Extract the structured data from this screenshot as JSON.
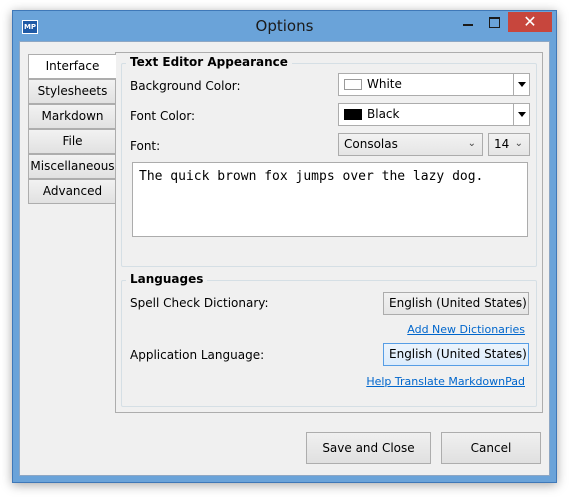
{
  "window": {
    "title": "Options",
    "app_icon": "MP"
  },
  "tabs": [
    {
      "label": "Interface",
      "active": true
    },
    {
      "label": "Stylesheets"
    },
    {
      "label": "Markdown"
    },
    {
      "label": "File"
    },
    {
      "label": "Miscellaneous"
    },
    {
      "label": "Advanced"
    }
  ],
  "editor": {
    "section_title": "Text Editor Appearance",
    "background_label": "Background Color:",
    "background_value": "White",
    "background_swatch": "#ffffff",
    "font_color_label": "Font Color:",
    "font_color_value": "Black",
    "font_color_swatch": "#000000",
    "font_label": "Font:",
    "font_value": "Consolas",
    "font_size": "14",
    "preview_text": "The quick brown fox jumps over the lazy dog."
  },
  "languages": {
    "section_title": "Languages",
    "spell_label": "Spell Check Dictionary:",
    "spell_value": "English (United States)",
    "add_link": "Add New Dictionaries",
    "app_lang_label": "Application Language:",
    "app_lang_value": "English (United States)",
    "help_link": "Help Translate MarkdownPad"
  },
  "buttons": {
    "save": "Save and Close",
    "cancel": "Cancel"
  }
}
